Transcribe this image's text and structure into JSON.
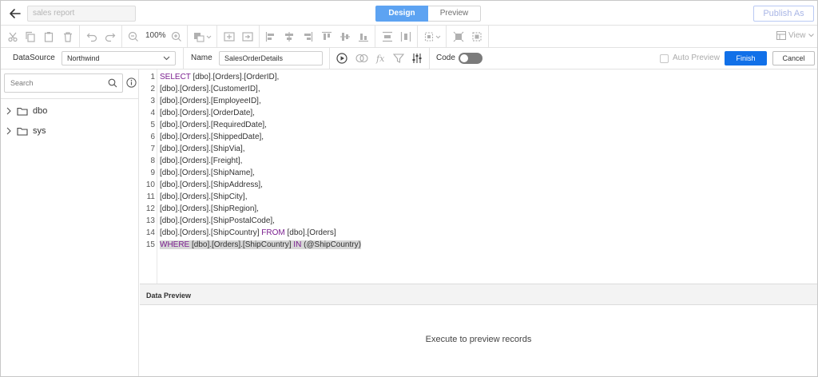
{
  "header": {
    "report_name_placeholder": "sales report",
    "tabs": [
      {
        "label": "Design",
        "active": true
      },
      {
        "label": "Preview",
        "active": false
      }
    ],
    "publish_label": "Publish As"
  },
  "toolbar": {
    "zoom_level": "100%",
    "view_label": "View",
    "icons": [
      "cut-icon",
      "copy-icon",
      "paste-icon",
      "delete-icon",
      "undo-icon",
      "redo-icon",
      "zoom-out-icon",
      "zoom-in-icon",
      "fill-color-icon",
      "align-icons",
      "view-icon"
    ]
  },
  "query_bar": {
    "datasource_label": "DataSource",
    "datasource_value": "Northwind",
    "name_label": "Name",
    "name_value": "SalesOrderDetails",
    "code_label": "Code",
    "code_enabled": false,
    "auto_preview_label": "Auto Preview",
    "finish_label": "Finish",
    "cancel_label": "Cancel",
    "accent_color": "#1170e8"
  },
  "schema_panel": {
    "search_placeholder": "Search",
    "tree": [
      {
        "label": "dbo",
        "expanded": false
      },
      {
        "label": "sys",
        "expanded": false
      }
    ]
  },
  "editor": {
    "lines": [
      {
        "num": "1",
        "kw": "SELECT",
        "text": " [dbo].[Orders].[OrderID],"
      },
      {
        "num": "2",
        "text": "[dbo].[Orders].[CustomerID],"
      },
      {
        "num": "3",
        "text": "[dbo].[Orders].[EmployeeID],"
      },
      {
        "num": "4",
        "text": "[dbo].[Orders].[OrderDate],"
      },
      {
        "num": "5",
        "text": "[dbo].[Orders].[RequiredDate],"
      },
      {
        "num": "6",
        "text": "[dbo].[Orders].[ShippedDate],"
      },
      {
        "num": "7",
        "text": "[dbo].[Orders].[ShipVia],"
      },
      {
        "num": "8",
        "text": "[dbo].[Orders].[Freight],"
      },
      {
        "num": "9",
        "text": "[dbo].[Orders].[ShipName],"
      },
      {
        "num": "10",
        "text": "[dbo].[Orders].[ShipAddress],"
      },
      {
        "num": "11",
        "text": "[dbo].[Orders].[ShipCity],"
      },
      {
        "num": "12",
        "text": "[dbo].[Orders].[ShipRegion],"
      },
      {
        "num": "13",
        "text": "[dbo].[Orders].[ShipPostalCode],"
      },
      {
        "num": "14",
        "text": "[dbo].[Orders].[ShipCountry]",
        "kw2": " FROM",
        "text2": " [dbo].[Orders]"
      },
      {
        "num": "15",
        "kw": "WHERE",
        "text": " [dbo].[Orders].[ShipCountry] ",
        "kw2": "IN",
        "text2": " (@ShipCountry)",
        "highlight": true
      }
    ]
  },
  "data_preview": {
    "title": "Data Preview",
    "message": "Execute to preview records"
  }
}
